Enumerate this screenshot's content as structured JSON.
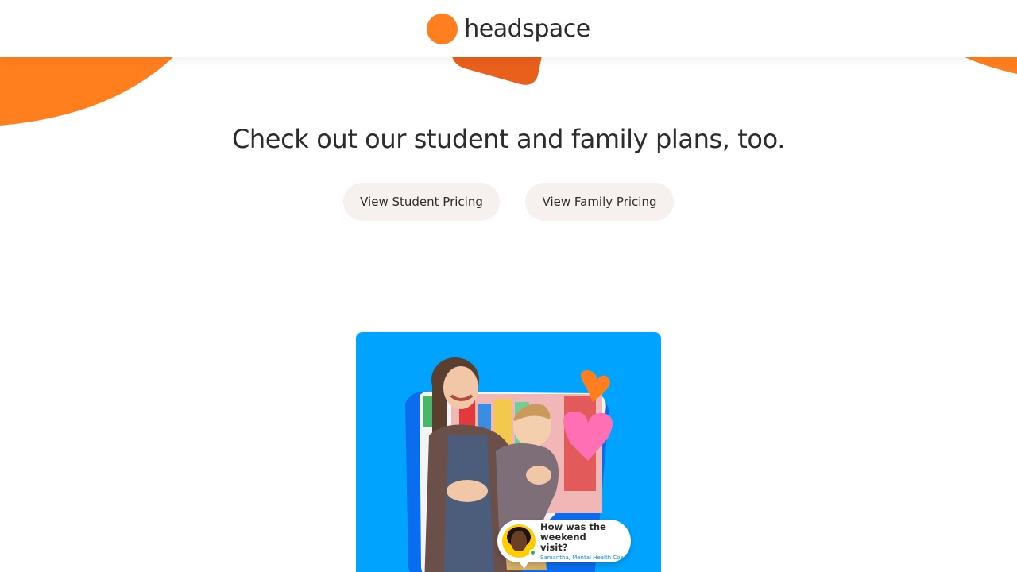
{
  "header": {
    "brand": "headspace",
    "brand_color": "#ff7f1f"
  },
  "main": {
    "headline": "Check out our student and family plans, too.",
    "buttons": {
      "student_label": "View Student Pricing",
      "family_label": "View Family Pricing"
    }
  },
  "promo": {
    "background_color": "#00a4ff",
    "chat_bubble": {
      "question": "How was the weekend visit?",
      "sender": "Samantha, Mental Health Coach"
    }
  },
  "colors": {
    "accent_orange": "#ff7f1f",
    "dark_orange": "#e8601c",
    "button_bg": "#f6f1ee",
    "text": "#2d2c2b"
  }
}
